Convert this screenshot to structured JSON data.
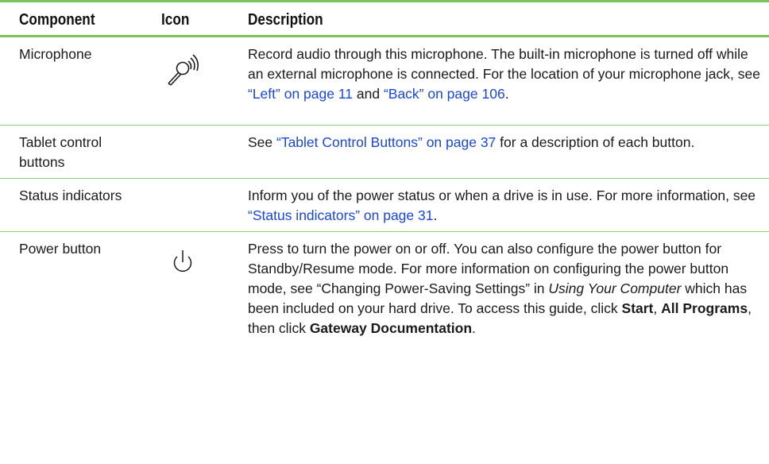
{
  "headers": {
    "component": "Component",
    "icon": "Icon",
    "description": "Description"
  },
  "rows": [
    {
      "component": "Microphone",
      "icon": "microphone-icon",
      "desc": {
        "t1": "Record audio through this microphone. The built-in microphone is turned off while an external microphone is connected. For the location of your microphone jack, see ",
        "link1": "“Left” on page 11",
        "t2": " and ",
        "link2": "“Back” on page 106",
        "t3": "."
      }
    },
    {
      "component": "Tablet control buttons",
      "icon": "",
      "desc": {
        "link1": "“Tablet Control Buttons” on page 37",
        "t1": " for a description of each button.",
        "t0": "See "
      }
    },
    {
      "component": "Status indicators",
      "icon": "",
      "desc": {
        "t1": "Inform you of the power status or when a drive is in use. For more information, see ",
        "link1": "“Status indicators” on page 31",
        "t2": "."
      }
    },
    {
      "component": "Power button",
      "icon": "power-icon",
      "desc": {
        "t1": "Press to turn the power on or off. You can also configure the power button for Standby/Resume mode. For more information on configuring the power button mode, see “Changing Power-Saving Settings” in ",
        "i1": "Using Your Computer",
        "t2": " which has been included on your hard drive. To access this guide, click ",
        "b1": "Start",
        "t3": ", ",
        "b2": "All Programs",
        "t4": ", then click ",
        "b3": "Gateway Documentation",
        "t5": "."
      }
    }
  ]
}
